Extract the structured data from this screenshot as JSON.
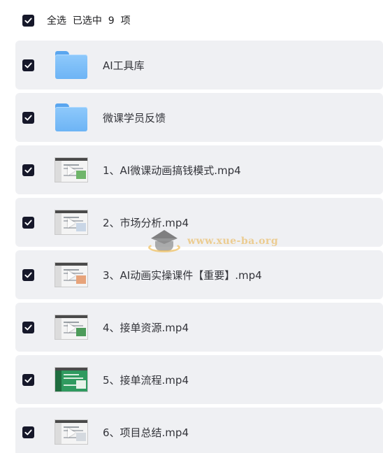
{
  "header": {
    "select_all_label": "全选  已选中  9  项",
    "checked": true
  },
  "items": [
    {
      "kind": "folder",
      "name": "AI工具库",
      "checked": true,
      "icon": "folder-icon"
    },
    {
      "kind": "folder",
      "name": "微课学员反馈",
      "checked": true,
      "icon": "folder-icon"
    },
    {
      "kind": "video",
      "name": "1、AI微课动画搞钱模式.mp4",
      "checked": true,
      "icon": "video-thumbnail"
    },
    {
      "kind": "video",
      "name": "2、市场分析.mp4",
      "checked": true,
      "icon": "video-thumbnail"
    },
    {
      "kind": "video",
      "name": "3、AI动画实操课件【重要】.mp4",
      "checked": true,
      "icon": "video-thumbnail"
    },
    {
      "kind": "video",
      "name": "4、接单资源.mp4",
      "checked": true,
      "icon": "video-thumbnail"
    },
    {
      "kind": "video",
      "name": "5、接单流程.mp4",
      "checked": true,
      "icon": "video-thumbnail"
    },
    {
      "kind": "video",
      "name": "6、项目总结.mp4",
      "checked": true,
      "icon": "video-thumbnail"
    }
  ],
  "watermark": {
    "text": "www.xue-ba.org",
    "icon": "graduation-cap-icon"
  },
  "colors": {
    "checkbox": "#16182a",
    "row_background": "#eff0f3",
    "folder_blue": "#6db4f5"
  }
}
